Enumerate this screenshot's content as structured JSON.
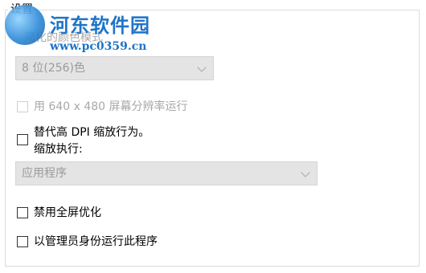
{
  "watermark": {
    "title": "河东软件园",
    "url": "www.pc0359.cn"
  },
  "group": {
    "title": "设置"
  },
  "color_mode": {
    "label": "简化的颜色模式",
    "selected": "8 位(256)色",
    "enabled": false
  },
  "resolution": {
    "label": "用 640 x 480 屏幕分辨率运行",
    "checked": false,
    "enabled": false
  },
  "dpi": {
    "label": "替代高 DPI 缩放行为。",
    "sub_label": "缩放执行:",
    "checked": false,
    "selected": "应用程序",
    "combo_enabled": false
  },
  "fullscreen": {
    "label": "禁用全屏优化",
    "checked": false
  },
  "admin": {
    "label": "以管理员身份运行此程序",
    "checked": false
  }
}
